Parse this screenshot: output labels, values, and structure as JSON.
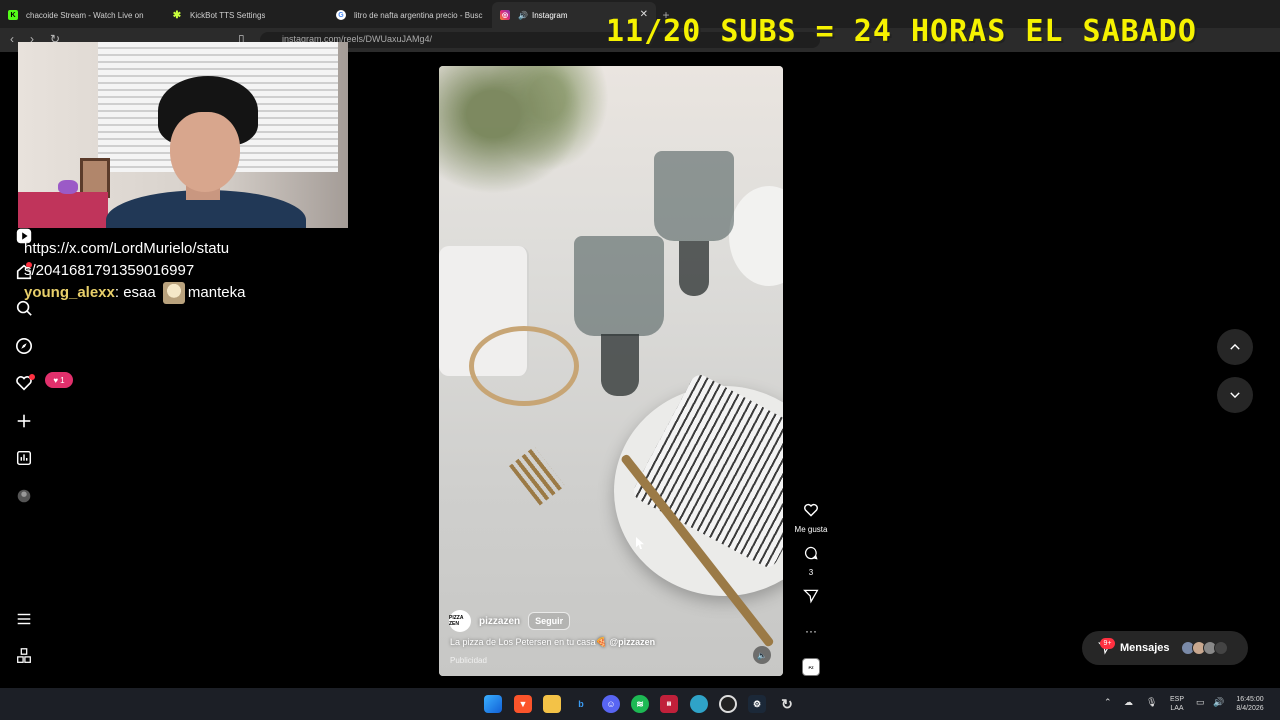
{
  "browser": {
    "tabs": [
      {
        "label": "chacoide Stream - Watch Live on",
        "favicon": "K",
        "color": "#53fc18"
      },
      {
        "label": "KickBot TTS Settings",
        "favicon": "✱",
        "color": "#c8ff3c"
      },
      {
        "label": "litro de nafta argentina precio - Busc",
        "favicon": "G",
        "color": "#ffffff"
      },
      {
        "label": "Instagram",
        "favicon": "◎",
        "color": "#e1306c"
      }
    ],
    "url": "instagram.com/reels/DWUaxuJAMg4/"
  },
  "overlay": {
    "title": "11/20 SUBS = 24 HORAS EL SABADO"
  },
  "chat": {
    "link_line1": "https://x.com/LordMurielo/statu",
    "link_line2": "s/2041681791359016997",
    "user": "young_alexx",
    "message_before": ": esaa",
    "message_after": "manteka"
  },
  "instagram": {
    "notifications_count": "1",
    "reel": {
      "username": "pizzazen",
      "avatar_text": "PIZZA ZEN",
      "follow_label": "Seguir",
      "caption": "La pizza de Los Petersen en tu casa🍕",
      "mention": "@pizzazen",
      "ad_label": "Publicidad"
    },
    "actions": {
      "like_label": "Me gusta",
      "comments_count": "3"
    },
    "messages": {
      "label": "Mensajes",
      "badge": "9+"
    }
  },
  "taskbar": {
    "lang_top": "ESP",
    "lang_bottom": "LAA",
    "time": "16:45:00",
    "date": "8/4/2026"
  }
}
